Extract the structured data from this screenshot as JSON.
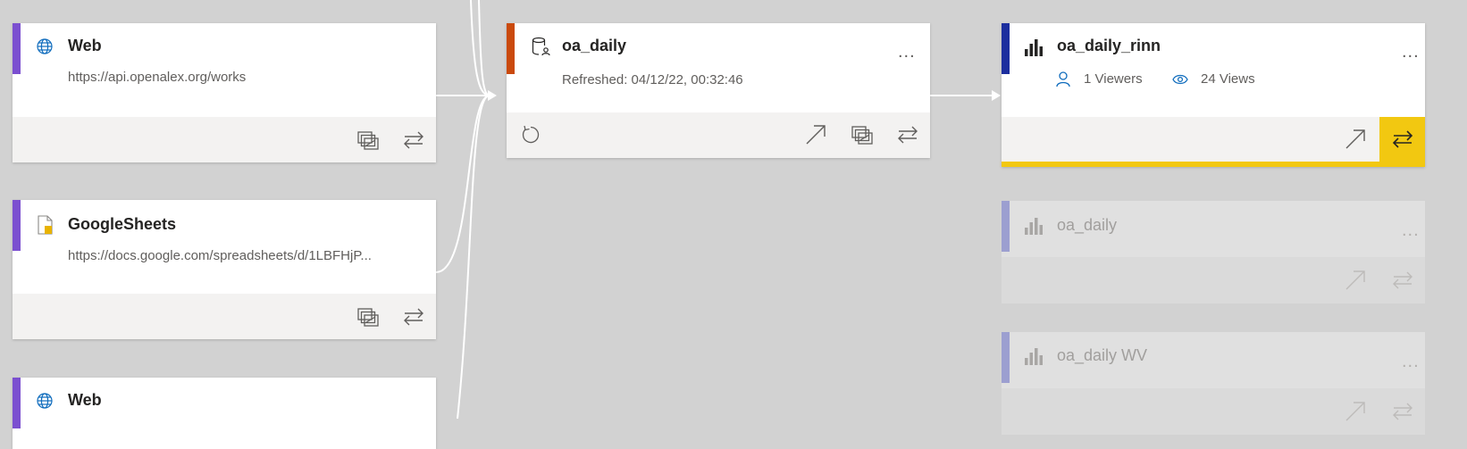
{
  "colors": {
    "canvas": "#d2d2d2",
    "source_accent": "#7b4fd0",
    "dataset_accent": "#ca4a0d",
    "report_accent": "#1c2e9e",
    "report_faded_accent": "#9c9fd0",
    "highlight": "#f2c811",
    "link_blue": "#0f6cbd"
  },
  "sources": [
    {
      "title": "Web",
      "url": "https://api.openalex.org/works",
      "icon": "globe-icon"
    },
    {
      "title": "GoogleSheets",
      "url": "https://docs.google.com/spreadsheets/d/1LBFHjP...",
      "icon": "file-icon"
    },
    {
      "title": "Web",
      "icon": "globe-icon"
    }
  ],
  "dataset": {
    "title": "oa_daily",
    "refreshed": "Refreshed: 04/12/22, 00:32:46",
    "more": "...",
    "icon": "dataset-icon"
  },
  "reports": [
    {
      "title": "oa_daily_rinn",
      "viewers": "1 Viewers",
      "views": "24 Views",
      "more": "...",
      "icon": "bar-chart-icon",
      "selected": true
    },
    {
      "title": "oa_daily",
      "more": "...",
      "icon": "bar-chart-icon",
      "selected": false
    },
    {
      "title": "oa_daily WV",
      "more": "...",
      "icon": "bar-chart-icon",
      "selected": false
    }
  ]
}
